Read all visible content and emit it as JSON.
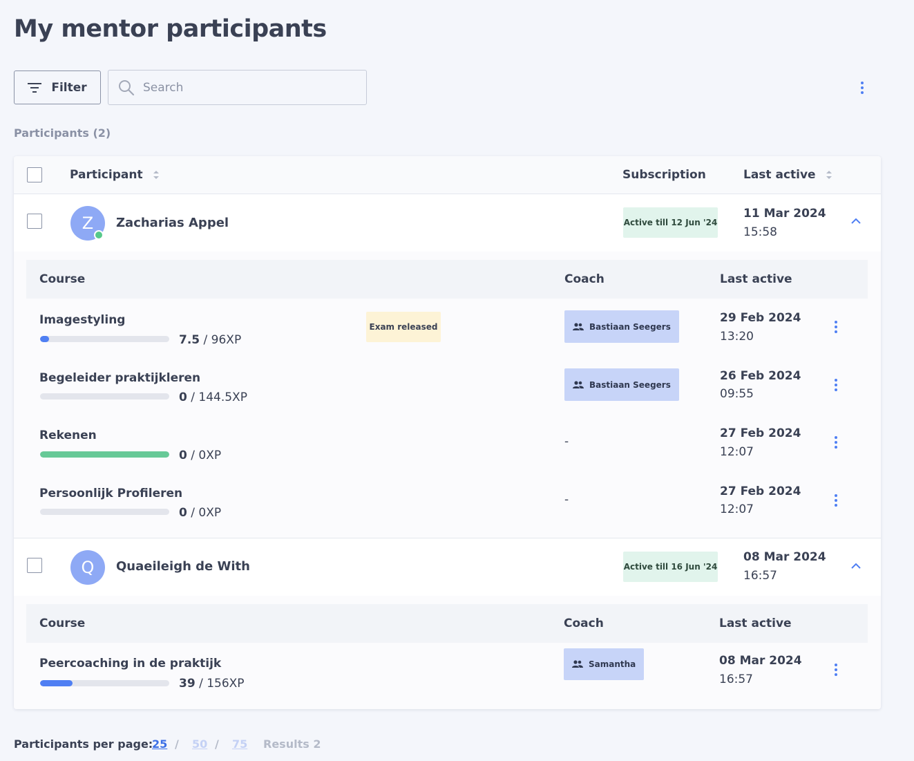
{
  "page": {
    "title": "My mentor participants"
  },
  "toolbar": {
    "filter_label": "Filter",
    "search_placeholder": "Search"
  },
  "participants_count_label": "Participants (2)",
  "table_headers": {
    "participant": "Participant",
    "subscription": "Subscription",
    "last_active": "Last active"
  },
  "course_headers": {
    "course": "Course",
    "coach": "Coach",
    "last_active": "Last active"
  },
  "participants": [
    {
      "initial": "Z",
      "name": "Zacharias Appel",
      "online": true,
      "subscription": "Active till 12 Jun '24",
      "last_active_date": "11 Mar 2024",
      "last_active_time": "15:58",
      "courses": [
        {
          "name": "Imagestyling",
          "xp_earned": "7.5",
          "xp_total": " / 96XP",
          "progress": 0.07,
          "progress_color": "#4f7ff3",
          "status": "Exam released",
          "coach": "Bastiaan Seegers",
          "date": "29 Feb 2024",
          "time": "13:20"
        },
        {
          "name": "Begeleider praktijkleren",
          "xp_earned": "0",
          "xp_total": " / 144.5XP",
          "progress": 0,
          "progress_color": "#4f7ff3",
          "status": "",
          "coach": "Bastiaan Seegers",
          "date": "26 Feb 2024",
          "time": "09:55"
        },
        {
          "name": "Rekenen",
          "xp_earned": "0",
          "xp_total": " / 0XP",
          "progress": 1.0,
          "progress_color": "#67c997",
          "status": "",
          "coach": "-",
          "date": "27 Feb 2024",
          "time": "12:07"
        },
        {
          "name": "Persoonlijk Profileren",
          "xp_earned": "0",
          "xp_total": " / 0XP",
          "progress": 0,
          "progress_color": "#4f7ff3",
          "status": "",
          "coach": "-",
          "date": "27 Feb 2024",
          "time": "12:07"
        }
      ]
    },
    {
      "initial": "Q",
      "name": "Quaeileigh de With",
      "online": false,
      "subscription": "Active till 16 Jun '24",
      "last_active_date": "08 Mar 2024",
      "last_active_time": "16:57",
      "courses": [
        {
          "name": "Peercoaching in de praktijk",
          "xp_earned": "39",
          "xp_total": " / 156XP",
          "progress": 0.25,
          "progress_color": "#4f7ff3",
          "status": "",
          "coach": "Samantha",
          "date": "08 Mar 2024",
          "time": "16:57"
        }
      ]
    }
  ],
  "pagination": {
    "label": "Participants per page:",
    "options": [
      "25",
      "50",
      "75"
    ],
    "separator": "/",
    "results": "Results 2"
  },
  "colors": {
    "accent": "#4f7ff3",
    "link_active": "#3b6fe6",
    "link_inactive": "#c4d1f5"
  }
}
